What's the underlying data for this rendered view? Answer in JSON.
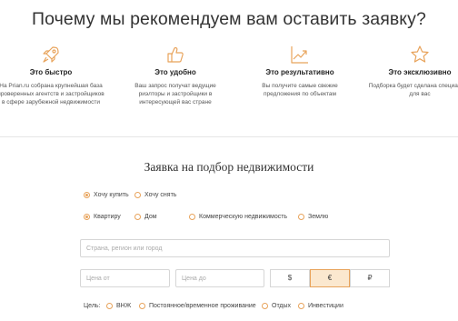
{
  "hero": {
    "title": "Почему мы рекомендуем вам оставить заявку?"
  },
  "benefits": [
    {
      "icon": "rocket-icon",
      "title": "Это быстро",
      "text": "На Prian.ru собрана крупнейшая база проверенных агентств и застройщиков в сфере зарубежной недвижимости"
    },
    {
      "icon": "thumbs-up-icon",
      "title": "Это удобно",
      "text": "Ваш запрос получат ведущие риэлторы и застройщики в интересующей вас стране"
    },
    {
      "icon": "growth-chart-icon",
      "title": "Это результативно",
      "text": "Вы получите самые свежие предложения по объектам"
    },
    {
      "icon": "star-icon",
      "title": "Это эксклюзивно",
      "text": "Подборка будет сделана специально для вас"
    }
  ],
  "form": {
    "title": "Заявка на подбор недвижимости",
    "deal": {
      "buy": "Хочу купить",
      "rent": "Хочу снять",
      "selected": "buy"
    },
    "type": {
      "apartment": "Квартиру",
      "house": "Дом",
      "commercial": "Коммерческую недвижимость",
      "land": "Землю",
      "selected": "apartment"
    },
    "location": {
      "placeholder": "Страна, регион или город",
      "value": ""
    },
    "price_from": {
      "placeholder": "Цена от",
      "value": ""
    },
    "price_to": {
      "placeholder": "Цена до",
      "value": ""
    },
    "currencies": {
      "usd": "$",
      "eur": "€",
      "rub": "₽",
      "selected": "eur"
    },
    "goal": {
      "label": "Цель:",
      "residence": "ВНЖ",
      "living": "Постоянное/временное проживание",
      "leisure": "Отдых",
      "investment": "Инвестиции"
    }
  },
  "colors": {
    "accent": "#e8a35b",
    "accent_bg": "#fbe8cf"
  }
}
